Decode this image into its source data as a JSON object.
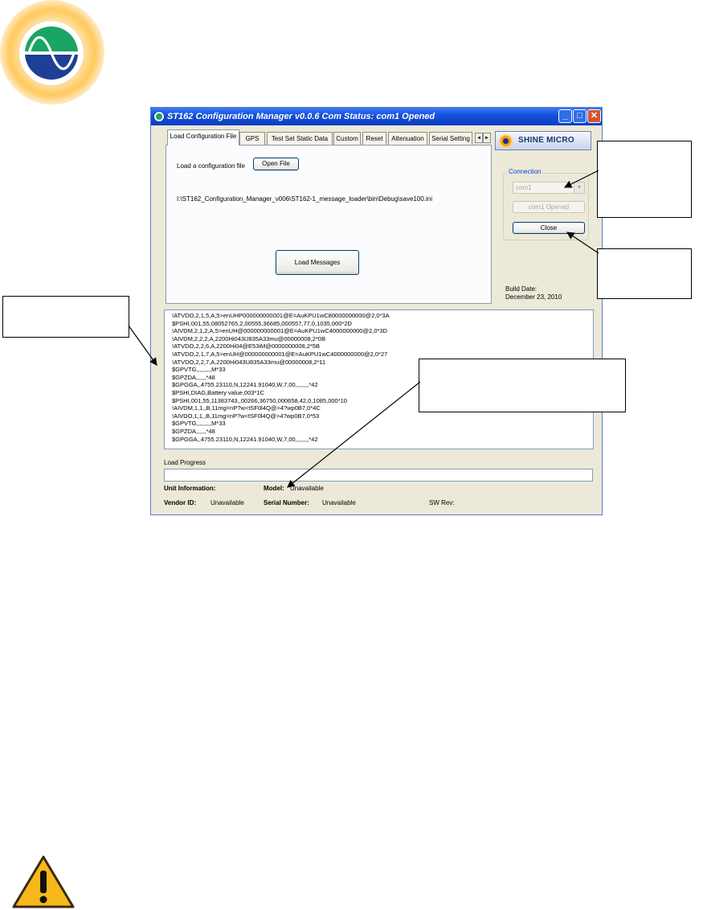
{
  "window": {
    "title": "ST162 Configuration Manager v0.0.6   Com Status: com1 Opened",
    "controls": {
      "minimize": "_",
      "maximize": "□",
      "close": "✕"
    }
  },
  "tabs": [
    {
      "label": "Load Configuration File",
      "active": true
    },
    {
      "label": "GPS",
      "active": false
    },
    {
      "label": "Test Set Static Data",
      "active": false
    },
    {
      "label": "Custom",
      "active": false
    },
    {
      "label": "Reset",
      "active": false
    },
    {
      "label": "Attenuation",
      "active": false
    },
    {
      "label": "Serial Setting",
      "active": false
    }
  ],
  "tab_scroll": {
    "left": "◄",
    "right": "►"
  },
  "load_panel": {
    "prompt": "Load a configuration file",
    "open_button": "Open File",
    "file_path": "I:\\ST162_Configuration_Manager_v006\\ST162-1_message_loader\\bin\\Debug\\save100.ini",
    "load_button": "Load Messages"
  },
  "brand": {
    "name": "SHINE MICRO"
  },
  "connection": {
    "group_label": "Connection",
    "port_value": "com1",
    "status_button": "com1 Opened",
    "close_button": "Close"
  },
  "build": {
    "label": "Build Date:",
    "date": "December 23, 2010"
  },
  "messages": [
    "!ATVDO,2,1,5,A,5>enUHP000000000001@E=AuKPU1wC80000000000@2,0*3A",
    "$PSHI,001,55,08052765,2,00555,36685,000557,77,0,1035,000*2D",
    "!AIVDM,2,1,2,A,5>enUH@000000000001@E=AuKPU1wC4000000000@2,0*3D",
    "!AIVDM,2,2,2,A,2200Hi043U835A33mu@00000008,2*0B",
    "!ATVDO,2,2,6,A,2200Hi04@E53iM@0000000008,2*5B",
    "!ATVDO,2,1,7,A,5>enUH@000000000001@E=AuKPU1wC4000000000@2,0*27",
    "!ATVDO,2,2,7,A,2200Hi043U835A33mu@00000008,2*11",
    "$GPVTG,,,,,,,,,M*33",
    "$GPZDA,,,,,,*48",
    "$GPGGA,,4755.23110,N,12241.91040,W,7,00,,,,,,,,*42",
    "$PSHI,DIAG,Battery value,003*1C",
    "$PSHI,001,55,11383743,,00266,36750,000658,42,0,1085,000*10",
    "!AIVDM,1,1,,B,11mg=nP?w<tSF0l4Q@>4?wp0B7,0*4C",
    "!AIVDO,1,1,,B,11mg=nP?w<tSF0l4Q@>4?wp0B7,0*53",
    "$GPVTG,,,,,,,,,M*33",
    "$GPZDA,,,,,,*48",
    "$GPGGA,,4755.23110,N,12241.91040,W,7,00,,,,,,,,*42"
  ],
  "progress": {
    "label": "Load Progress",
    "value": 0
  },
  "unit_info": {
    "heading": "Unit Information:",
    "model_label": "Model:",
    "model_value": "Unavailable",
    "vendor_label": "Vendor ID:",
    "vendor_value": "Unavailable",
    "serial_label": "Serial Number:",
    "serial_value": "Unavailable",
    "sw_label": "SW Rev:",
    "sw_value": ""
  },
  "icons": {
    "logo": "sine-wave-logo-icon",
    "warning": "warning-icon",
    "brand": "shine-micro-logo-icon"
  },
  "colors": {
    "titlebar": "#1450d9",
    "window_bg": "#ece9d8",
    "logo_orange": "#ffc95c",
    "logo_green": "#1aa564",
    "logo_blue": "#1d3f95",
    "warning_yellow": "#f6b81a"
  }
}
